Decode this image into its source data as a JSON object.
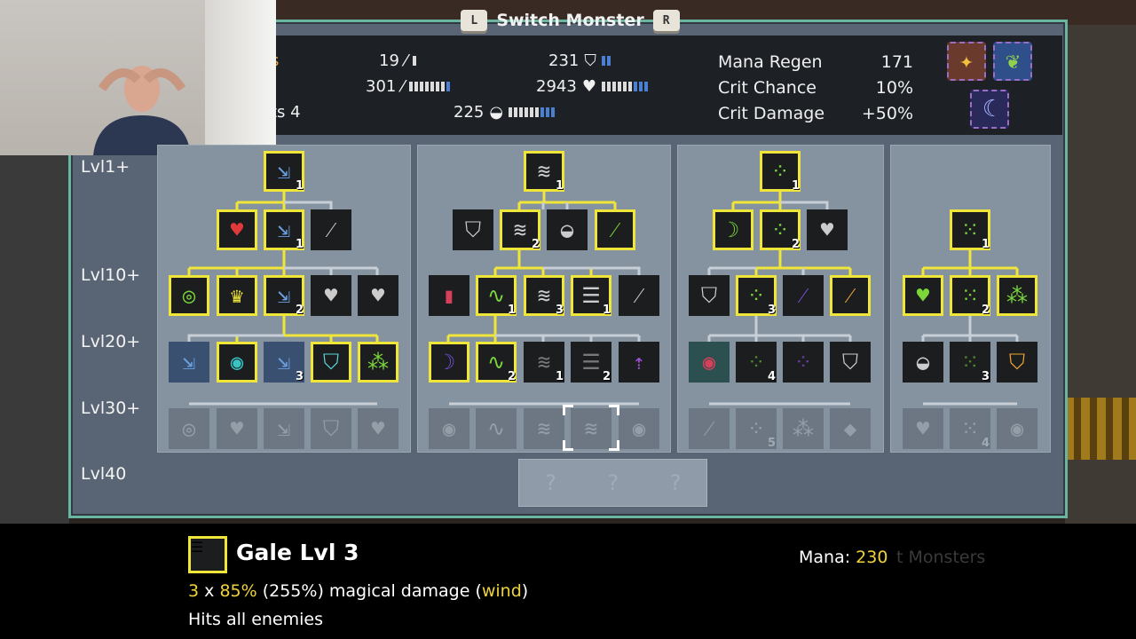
{
  "title": {
    "left_key": "L",
    "label": "Switch Monster",
    "right_key": "R"
  },
  "stats": {
    "attack": "19",
    "magic": "231",
    "attack_speed": "301",
    "health": "2943",
    "defense": "225",
    "partial_left_1": "s",
    "partial_left_3": "ts 4"
  },
  "side_stats": [
    {
      "label": "Mana Regen",
      "value": "171"
    },
    {
      "label": "Crit Chance",
      "value": "10%"
    },
    {
      "label": "Crit Damage",
      "value": "+50%"
    }
  ],
  "levels": [
    "Lvl1+",
    "Lvl10+",
    "Lvl20+",
    "Lvl30+",
    "Lvl40"
  ],
  "nodes": {
    "c1_top": "1",
    "c1_r2b": "1",
    "c1_r3c": "2",
    "c1_r4c": "3",
    "c2_top": "1",
    "c2_r2b": "2",
    "c2_r3b": "1",
    "c2_r3c": "3",
    "c2_r3d": "1",
    "c2_r4b": "2",
    "c2_r4c": "1",
    "c2_r4d": "2",
    "c3_top": "1",
    "c3_r2b": "2",
    "c3_r3a": "3",
    "c3_r4b": "4",
    "c3_r5b": "5",
    "c4_top": "1",
    "c4_r3b": "2",
    "c4_r4b": "3",
    "c4_r5b": "4"
  },
  "locked": [
    "?",
    "?",
    "?"
  ],
  "selected_skill": {
    "name": "Gale Lvl 3",
    "count": "3",
    "x": "x",
    "pct": "85%",
    "total": "(255%) magical damage",
    "element": "wind",
    "extra": "Hits all enemies",
    "mana_label": "Mana:",
    "mana_value": "230",
    "bg_ghost": "t Monsters"
  }
}
